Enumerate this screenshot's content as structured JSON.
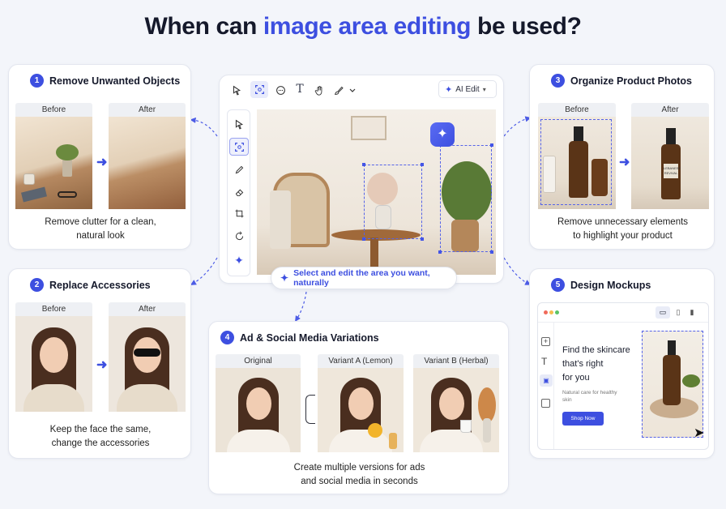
{
  "title": {
    "prefix": "When can ",
    "accent": "image area editing",
    "suffix": " be used?"
  },
  "colors": {
    "accent": "#3d4fe0",
    "background": "#f3f5fa",
    "card": "#ffffff"
  },
  "cards": {
    "c1": {
      "num": "1",
      "title": "Remove Unwanted Objects",
      "before": "Before",
      "after": "After",
      "caption1": "Remove clutter for a clean,",
      "caption2": "natural look"
    },
    "c2": {
      "num": "2",
      "title": "Replace Accessories",
      "before": "Before",
      "after": "After",
      "caption1": "Keep the face the same,",
      "caption2": "change the accessories"
    },
    "c3": {
      "num": "3",
      "title": "Organize Product Photos",
      "before": "Before",
      "after": "After",
      "caption1": "Remove unnecessary elements",
      "caption2": "to highlight your product"
    },
    "c4": {
      "num": "4",
      "title": "Ad & Social Media Variations",
      "original": "Original",
      "variantA": "Variant A (Lemon)",
      "variantB": "Variant B (Herbal)",
      "caption1": "Create multiple versions for ads",
      "caption2": "and social media in seconds"
    },
    "c5": {
      "num": "5",
      "title": "Design Mockups",
      "heading1": "Find the skincare",
      "heading2": "that's right",
      "heading3": "for you",
      "sub1": "Natural care for healthy",
      "sub2": "skin",
      "button": "Shop Now"
    }
  },
  "editor": {
    "ai_edit": "AI Edit",
    "hint": "Select and edit the area you want, naturally",
    "toolbar_icons": [
      "cursor-icon",
      "area-select-icon",
      "comment-icon",
      "text-icon",
      "hand-icon",
      "brush-icon",
      "chevron-down-icon"
    ],
    "side_icons": [
      "cursor-icon",
      "area-select-icon",
      "pencil-icon",
      "eraser-icon",
      "crop-icon",
      "rotate-icon",
      "sparkle-icon"
    ]
  },
  "product": {
    "label_line1": "LEBANESE",
    "label_line2": "REVIVAL"
  }
}
